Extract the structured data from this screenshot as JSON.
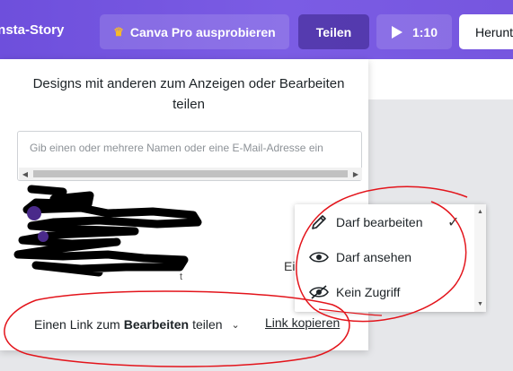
{
  "topbar": {
    "app_title": "Insta-Story",
    "pro_button": "Canva Pro ausprobieren",
    "share_button": "Teilen",
    "play_time": "1:10",
    "download_label": "Herunterladen"
  },
  "share_panel": {
    "title": "Designs mit anderen zum Anzeigen oder Bearbeiten teilen",
    "email_placeholder": "Gib einen oder mehrere Namen oder eine E-Mail-Adresse ein",
    "partial_text": "Ei",
    "partial_t": "t",
    "link_prefix": "Einen Link zum",
    "link_bold": "Bearbeiten",
    "link_suffix": "teilen",
    "copy_link": "Link kopieren"
  },
  "permissions": {
    "items": [
      {
        "label": "Darf bearbeiten",
        "icon": "pencil-icon",
        "selected": true
      },
      {
        "label": "Darf ansehen",
        "icon": "eye-icon",
        "selected": false
      },
      {
        "label": "Kein Zugriff",
        "icon": "eye-off-icon",
        "selected": false
      }
    ]
  },
  "colors": {
    "topbar_start": "#6e4fdc",
    "topbar_end": "#7656df",
    "annotation": "#e3141b",
    "crown": "#f7b928"
  }
}
